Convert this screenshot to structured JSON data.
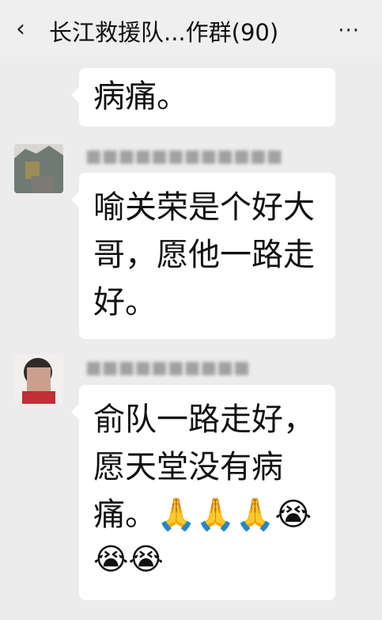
{
  "header": {
    "back_icon": "‹",
    "title": "长江救援队...作群(90)",
    "more_icon": "···"
  },
  "messages": [
    {
      "bubble_lines": [
        "病痛。"
      ]
    },
    {
      "sender": "■■■■■■■■■■■■",
      "bubble_lines": [
        "喻关荣是个好大",
        "哥，愿他一路走",
        "好。"
      ]
    },
    {
      "sender": "■■■■■■■■■■",
      "bubble_lines": [
        "俞队一路走好，",
        "愿天堂没有病",
        "痛。🙏🙏🙏😭",
        "😭😭"
      ]
    }
  ]
}
